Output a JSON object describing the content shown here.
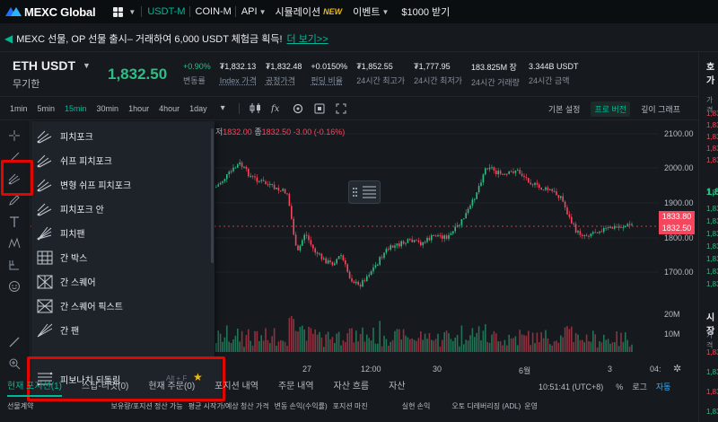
{
  "nav": {
    "logo": "MEXC Global",
    "items": [
      {
        "label": "USDT-M",
        "active": true
      },
      {
        "label": "COIN-M"
      },
      {
        "label": "API"
      },
      {
        "label": "시뮬레이션",
        "badge": "NEW"
      },
      {
        "label": "이벤트"
      },
      {
        "label": "$1000 받기"
      }
    ]
  },
  "banner": {
    "text": "MEXC 선물, OP 선물 출시– 거래하여 6,000 USDT 체험금 획득!",
    "link": "더 보기>>"
  },
  "ticker": {
    "symbol": "ETH USDT",
    "subtitle": "무기한",
    "price": "1,832.50",
    "stats": [
      {
        "value": "+0.90%",
        "label": "변동률",
        "green": true
      },
      {
        "value": "₮1,832.13",
        "label": "Index 가격",
        "underline": true
      },
      {
        "value": "₮1,832.48",
        "label": "공정가격",
        "underline": true
      },
      {
        "value": "+0.0150%",
        "label": "펀딩 비율",
        "underline": true
      },
      {
        "value": "₮1,852.55",
        "label": "24시간 최고가"
      },
      {
        "value": "₮1,777.95",
        "label": "24시간 최저가"
      },
      {
        "value": "183.825M 장",
        "label": "24시간 거래량"
      },
      {
        "value": "3.344B USDT",
        "label": "24시간 금액"
      }
    ]
  },
  "timeframes": [
    "1min",
    "5min",
    "15min",
    "30min",
    "1hour",
    "4hour",
    "1day"
  ],
  "active_timeframe": "15min",
  "views": [
    "기본 설정",
    "프로 버전",
    "깊이 그래프"
  ],
  "active_view": "프로 버전",
  "ohlc": {
    "prefix": "저",
    "low": "1832.00",
    "close_label": "종",
    "close": "1832.50",
    "change": "-3.00 (-0.16%)"
  },
  "price_axis": {
    "labels": [
      "2100.00",
      "2000.00",
      "1900.00",
      "1800.00",
      "1700.00"
    ],
    "volume_labels": [
      "20M",
      "10M"
    ]
  },
  "price_tags": {
    "mark": "1833.80",
    "last": "1832.50"
  },
  "x_axis": [
    "27",
    "12:00",
    "30",
    "6월",
    "3",
    "04:"
  ],
  "clock": "10:51:41 (UTC+8)",
  "scale_buttons": {
    "pct": "%",
    "log": "로그",
    "auto": "자동"
  },
  "drawing_menu": {
    "items": [
      "피치포크",
      "쉬프 피치포크",
      "변형 쉬프 피치포크",
      "피치포크 안",
      "피치팬",
      "간 박스",
      "간 스퀘어",
      "간 스퀘어 픽스트",
      "간 팬"
    ],
    "highlight": {
      "label": "피보나치 되돌림",
      "shortcut": "Alt + F"
    }
  },
  "bottom_tabs": [
    "현재 포지션(1)",
    "스탑-리밋(0)",
    "현재 주문(0)",
    "포지션 내역",
    "주문 내역",
    "자산 흐름",
    "자산"
  ],
  "bottom_cols": [
    "선물계약",
    "보유량/포지션 정산 가능",
    "평균 시작가/예상 청산 가격",
    "변동 손익(수익률)",
    "포지션 마진",
    "실현 손익",
    "오토 디레버리징 (ADL)",
    "운영"
  ],
  "right_panel": {
    "header": "호가",
    "sub": "가격",
    "prices": [
      "1,83",
      "1,83",
      "1,83",
      "1,83",
      "1,83",
      "1,83",
      "1,83",
      "1,83",
      "1,83",
      "1,83",
      "1,83",
      "1,83",
      "1,83"
    ],
    "big": "1,8",
    "header2": "시장",
    "sub2": "가격",
    "prices2": [
      "1,83",
      "1,83",
      "1,83",
      "1,83"
    ]
  },
  "colors": {
    "up": "#2ebd85",
    "down": "#f6465d",
    "accent": "#00b897",
    "highlight_box": "#e10600"
  }
}
